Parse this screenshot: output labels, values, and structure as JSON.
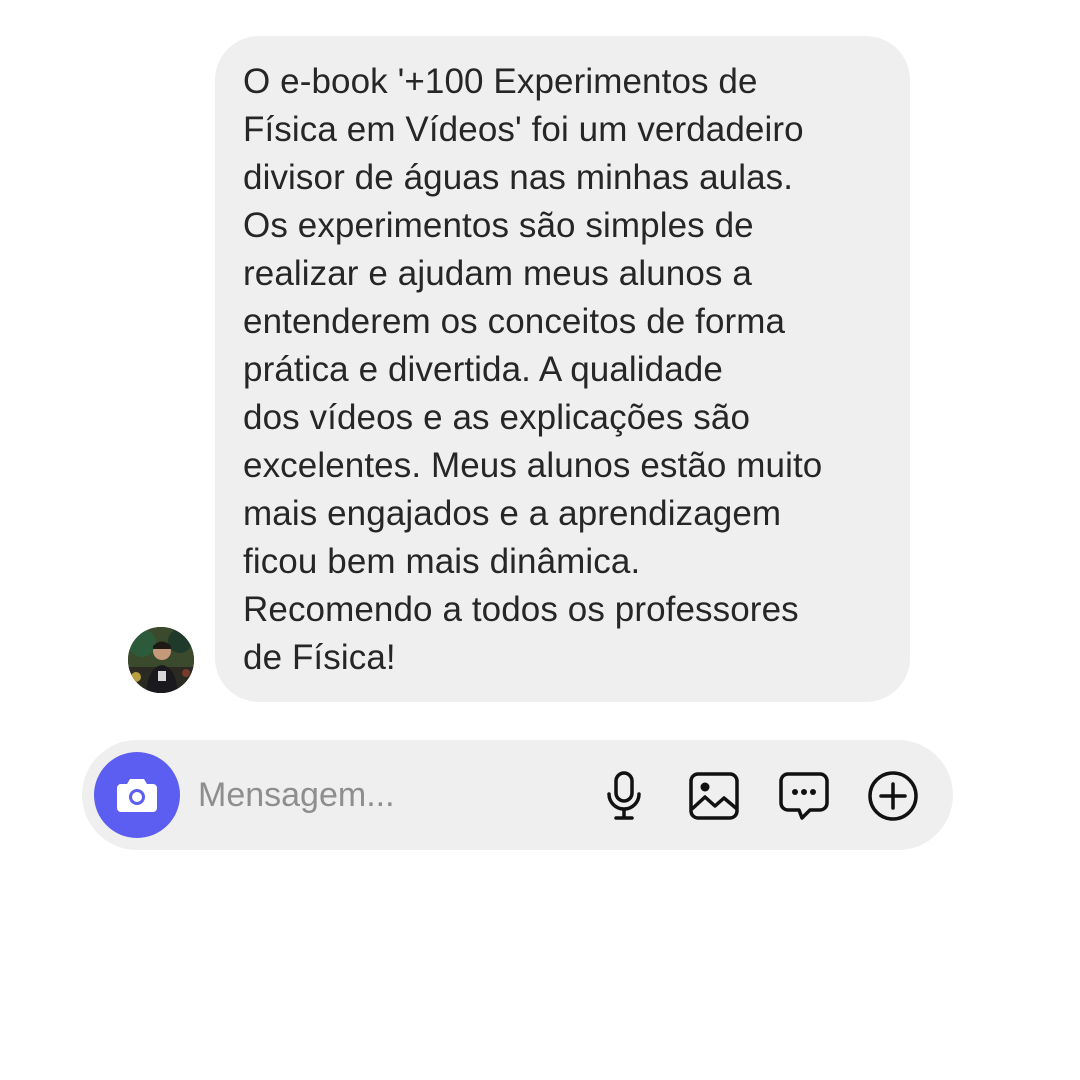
{
  "message": {
    "text": "O e-book '+100 Experimentos de\nFísica em Vídeos' foi um verdadeiro\ndivisor de águas nas minhas aulas.\nOs experimentos são simples de\nrealizar e ajudam meus alunos a\nentenderem os conceitos de forma\nprática e divertida. A qualidade\ndos vídeos e as explicações são\nexcelentes. Meus alunos estão muito\nmais engajados e a aprendizagem\nficou bem mais dinâmica.\nRecomendo a todos os professores\nde Física!"
  },
  "composer": {
    "placeholder": "Mensagem...",
    "value": ""
  },
  "icons": {
    "camera": "camera-icon",
    "mic": "microphone-icon",
    "gallery": "image-icon",
    "sticker": "chat-bubble-icon",
    "plus": "plus-circle-icon"
  },
  "colors": {
    "accent": "#5b5ef0",
    "bubble": "#efefef",
    "text": "#262626",
    "placeholder": "#8e8e8e"
  }
}
